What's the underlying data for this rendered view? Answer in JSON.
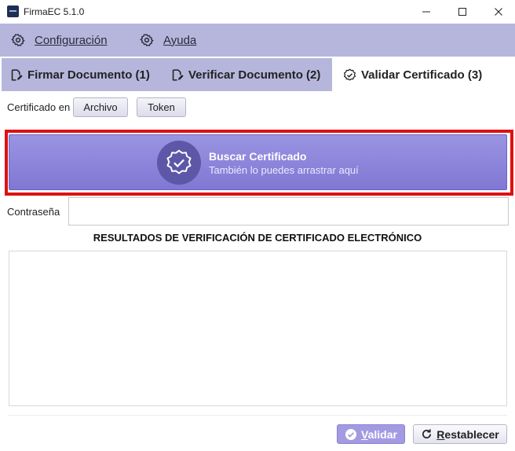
{
  "window": {
    "title": "FirmaEC 5.1.0",
    "icons": {
      "app": "firmaec-logo-icon",
      "minimize": "minimize-icon",
      "maximize": "maximize-icon",
      "close": "close-icon"
    }
  },
  "menu": {
    "items": [
      {
        "label": "Configuración",
        "icon": "gear-icon"
      },
      {
        "label": "Ayuda",
        "icon": "gear-icon"
      }
    ]
  },
  "tabs": [
    {
      "label": "Firmar Documento (1)",
      "icon": "edit-document-icon",
      "active": false
    },
    {
      "label": "Verificar Documento (2)",
      "icon": "edit-document-icon",
      "active": false
    },
    {
      "label": "Validar Certificado (3)",
      "icon": "verified-badge-icon",
      "active": true
    }
  ],
  "certificate_source": {
    "label": "Certificado en",
    "options": [
      "Archivo",
      "Token"
    ]
  },
  "search_certificate": {
    "title": "Buscar Certificado",
    "subtitle": "También lo puedes arrastrar aquí",
    "icon": "verified-badge-icon"
  },
  "password": {
    "label": "Contraseña",
    "value": "",
    "placeholder": ""
  },
  "results": {
    "title": "RESULTADOS DE VERIFICACIÓN DE CERTIFICADO ELECTRÓNICO",
    "content": ""
  },
  "actions": {
    "validate_label": "Validar",
    "reset_label": "Restablecer"
  },
  "colors": {
    "accent": "#8a82d8",
    "menu_background": "#b6b6dd",
    "highlight": "#dd1111"
  }
}
